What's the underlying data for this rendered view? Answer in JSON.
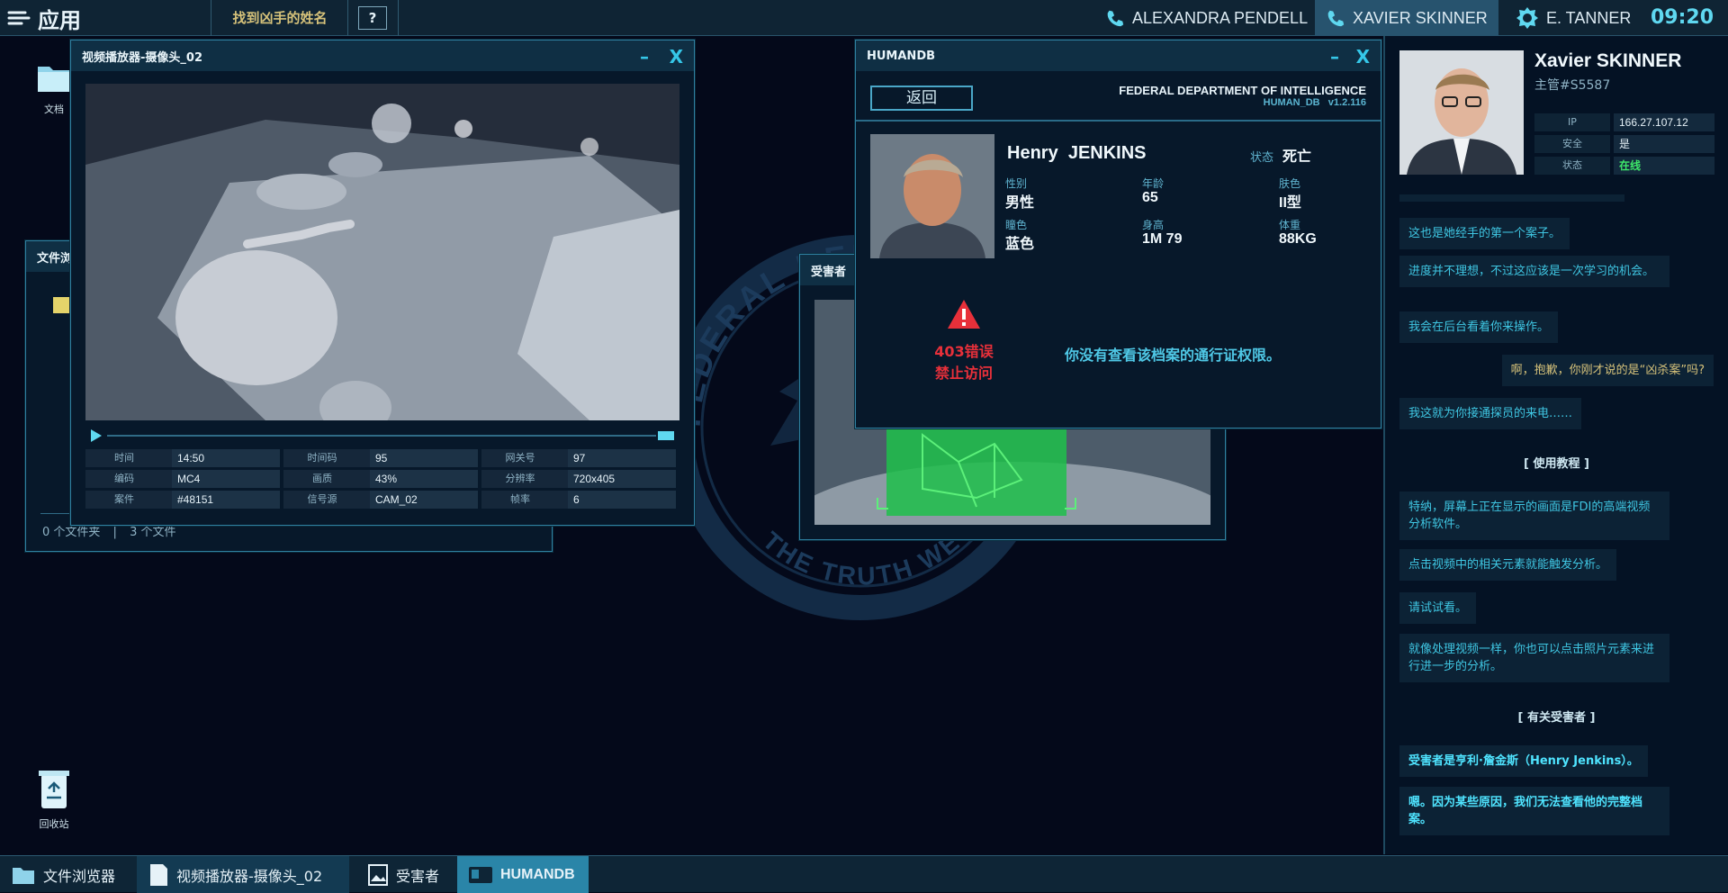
{
  "topbar": {
    "apps_label": "应用",
    "objective": "找到凶手的姓名",
    "help": "?",
    "contacts": [
      {
        "name": "ALEXANDRA PENDELL",
        "icon": "phone-icon"
      },
      {
        "name": "XAVIER SKINNER",
        "icon": "phone-icon"
      },
      {
        "name": "E. TANNER",
        "icon": "fdi-badge-icon"
      }
    ],
    "clock": "09:20"
  },
  "desktop": {
    "icons": [
      {
        "label": "文档",
        "icon": "folder-icon"
      },
      {
        "label": "回收站",
        "icon": "recycle-bin-icon"
      }
    ],
    "seal_text": "FEDERAL DEPARTMENT · THE TRUTH WE SEEK"
  },
  "file_browser": {
    "title": "文件浏",
    "footer_folders": "0 个文件夹",
    "footer_files": "3 个文件"
  },
  "victim_window": {
    "title": "受害者"
  },
  "video_player": {
    "title": "视频播放器-摄像头_02",
    "fields": [
      {
        "label": "时间",
        "value": "14:50"
      },
      {
        "label": "时间码",
        "value": "95"
      },
      {
        "label": "网关号",
        "value": "97"
      },
      {
        "label": "编码",
        "value": "MC4"
      },
      {
        "label": "画质",
        "value": "43%"
      },
      {
        "label": "分辨率",
        "value": "720x405"
      },
      {
        "label": "案件",
        "value": "#48151"
      },
      {
        "label": "信号源",
        "value": "CAM_02"
      },
      {
        "label": "帧率",
        "value": "6"
      }
    ]
  },
  "humandb": {
    "title": "HUMANDB",
    "back": "返回",
    "org": "FEDERAL DEPARTMENT OF INTELLIGENCE",
    "db": "HUMAN_DB",
    "version": "v1.2.116",
    "person": {
      "first": "Henry",
      "last": "JENKINS",
      "status_label": "状态",
      "status": "死亡",
      "gender_label": "性别",
      "gender": "男性",
      "age_label": "年龄",
      "age": "65",
      "skin_label": "肤色",
      "skin": "II型",
      "eye_label": "瞳色",
      "eye": "蓝色",
      "height_label": "身高",
      "height": "1M 79",
      "weight_label": "体重",
      "weight": "88KG"
    },
    "error_code": "403错误",
    "error_title": "禁止访问",
    "error_msg": "你没有查看该档案的通行证权限。"
  },
  "chat": {
    "name": "Xavier SKINNER",
    "id": "主管#S5587",
    "info": [
      {
        "label": "IP",
        "value": "166.27.107.12"
      },
      {
        "label": "安全",
        "value": "是"
      },
      {
        "label": "状态",
        "value": "在线"
      }
    ],
    "messages": [
      {
        "text": "这也是她经手的第一个案子。"
      },
      {
        "text": "进度并不理想，不过这应该是一次学习的机会。"
      },
      {
        "text": "我会在后台看着你来操作。"
      },
      {
        "text": "啊，抱歉，你刚才说的是“凶杀案”吗?"
      },
      {
        "text": "我这就为你接通探员的来电……"
      },
      {
        "text": "[ 使用教程 ]"
      },
      {
        "text": "特纳，屏幕上正在显示的画面是FDI的高端视频分析软件。"
      },
      {
        "text": "点击视频中的相关元素就能触发分析。"
      },
      {
        "text": "请试试看。"
      },
      {
        "text": "就像处理视频一样，你也可以点击照片元素来进行进一步的分析。"
      },
      {
        "text": "[ 有关受害者 ]"
      },
      {
        "text": "受害者是亨利·詹金斯（Henry Jenkins）。"
      },
      {
        "text": "嗯。因为某些原因，我们无法查看他的完整档案。"
      }
    ]
  },
  "taskbar": {
    "items": [
      {
        "label": "文件浏览器",
        "icon": "folder-icon"
      },
      {
        "label": "视频播放器-摄像头_02",
        "icon": "video-icon"
      },
      {
        "label": "受害者",
        "icon": "image-icon"
      },
      {
        "label": "HUMANDB",
        "icon": "database-icon"
      }
    ]
  },
  "colors": {
    "accent": "#35c7e8",
    "error": "#e8303a",
    "online": "#3ee86a",
    "objective": "#d6c27a"
  }
}
